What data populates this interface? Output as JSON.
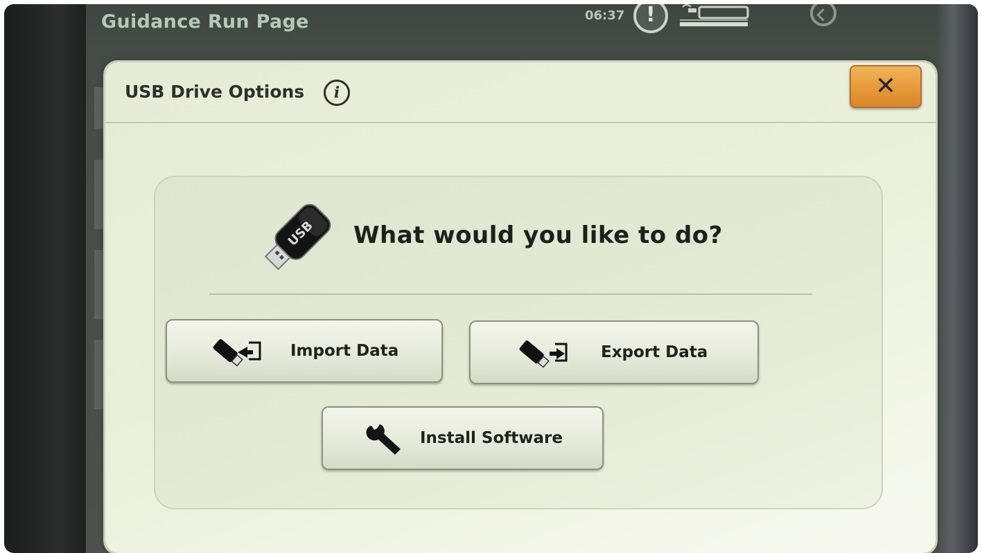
{
  "topbar": {
    "page_title": "Guidance Run Page",
    "clock": "06:37"
  },
  "dialog": {
    "title": "USB Drive Options",
    "prompt": "What would you like to do?",
    "buttons": {
      "import": "Import Data",
      "export": "Export Data",
      "install": "Install Software"
    }
  },
  "icons": {
    "info": "info-icon",
    "close": "close-icon",
    "usb": "usb-drive-icon",
    "import": "usb-import-icon",
    "export": "usb-export-icon",
    "install": "wrench-icon",
    "alert": "alert-icon",
    "back": "back-icon"
  },
  "colors": {
    "close_button": "#e79a3a",
    "dialog_background": "#e9efd9",
    "screen_background": "#434c45"
  }
}
